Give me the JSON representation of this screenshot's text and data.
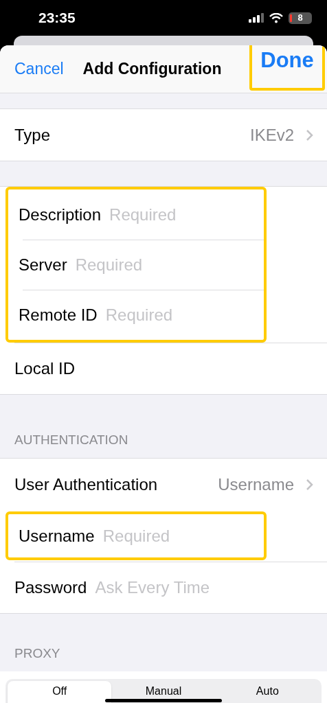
{
  "status_bar": {
    "time": "23:35",
    "battery": "8"
  },
  "nav": {
    "cancel": "Cancel",
    "title": "Add Configuration",
    "done": "Done",
    "done_highlighted": true
  },
  "sections": [
    {
      "rows": [
        {
          "kind": "disclosure",
          "label": "Type",
          "value": "IKEv2",
          "highlighted": false
        }
      ]
    },
    {
      "rows": [
        {
          "kind": "field",
          "label": "Description",
          "placeholder": "Required",
          "highlighted": true
        },
        {
          "kind": "field",
          "label": "Server",
          "placeholder": "Required",
          "highlighted": true
        },
        {
          "kind": "field",
          "label": "Remote ID",
          "placeholder": "Required",
          "highlighted": true
        },
        {
          "kind": "field",
          "label": "Local ID",
          "highlighted": false
        }
      ]
    },
    {
      "header": "AUTHENTICATION",
      "rows": [
        {
          "kind": "disclosure",
          "label": "User Authentication",
          "value": "Username",
          "highlighted": false
        },
        {
          "kind": "field",
          "label": "Username",
          "placeholder": "Required",
          "highlighted": true
        },
        {
          "kind": "field",
          "label": "Password",
          "placeholder": "Ask Every Time",
          "highlighted": false
        }
      ]
    },
    {
      "header": "PROXY",
      "segments": [
        {
          "label": "Off",
          "selected": true
        },
        {
          "label": "Manual",
          "selected": false
        },
        {
          "label": "Auto",
          "selected": false
        }
      ]
    }
  ]
}
